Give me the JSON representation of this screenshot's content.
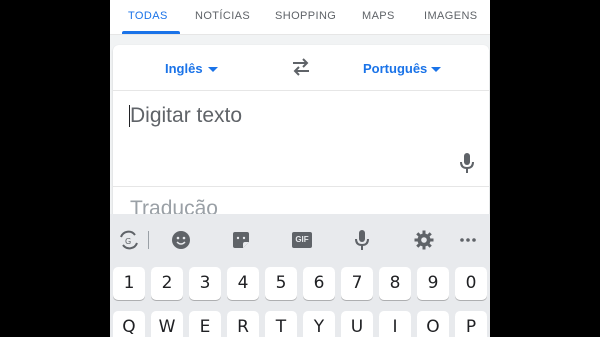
{
  "tabs": [
    {
      "label": "TODAS",
      "active": true
    },
    {
      "label": "NOTÍCIAS",
      "active": false
    },
    {
      "label": "SHOPPING",
      "active": false
    },
    {
      "label": "MAPS",
      "active": false
    },
    {
      "label": "IMAGENS",
      "active": false
    }
  ],
  "translator": {
    "source_language": "Inglês",
    "target_language": "Português",
    "input_placeholder": "Digitar texto",
    "translation_label": "Tradução"
  },
  "keyboard": {
    "toolbar_icons": [
      "translate-icon",
      "emoji-icon",
      "sticker-icon",
      "gif-icon",
      "mic-icon",
      "settings-icon",
      "more-icon"
    ],
    "gif_label": "GIF",
    "number_row": [
      "1",
      "2",
      "3",
      "4",
      "5",
      "6",
      "7",
      "8",
      "9",
      "0"
    ],
    "letter_row": [
      "Q",
      "W",
      "E",
      "R",
      "T",
      "Y",
      "U",
      "I",
      "O",
      "P"
    ]
  },
  "colors": {
    "accent": "#1a73e8",
    "text_secondary": "#5f6368",
    "keyboard_bg": "#e8eaed",
    "background": "#000000"
  }
}
